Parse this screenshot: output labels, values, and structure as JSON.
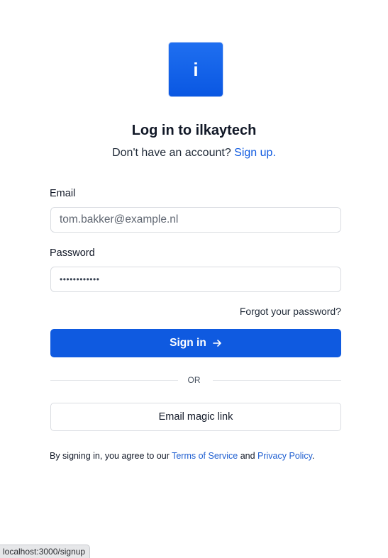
{
  "logo": {
    "letter": "i"
  },
  "header": {
    "title": "Log in to ilkaytech",
    "subtitle_prefix": "Don't have an account?",
    "signup_link": "Sign up."
  },
  "form": {
    "email_label": "Email",
    "email_placeholder": "tom.bakker@example.nl",
    "password_label": "Password",
    "password_mask": "••••••••••••",
    "forgot_link": "Forgot your password?",
    "signin_label": "Sign in",
    "divider_text": "OR",
    "magic_link_label": "Email magic link"
  },
  "legal": {
    "prefix": "By signing in, you agree to our",
    "terms_link": "Terms of Service",
    "and": "and",
    "privacy_link": "Privacy Policy",
    "suffix": "."
  },
  "status_bar": {
    "url": "localhost:3000/signup"
  },
  "colors": {
    "accent": "#0f5ae0",
    "border": "#d9dce1"
  }
}
